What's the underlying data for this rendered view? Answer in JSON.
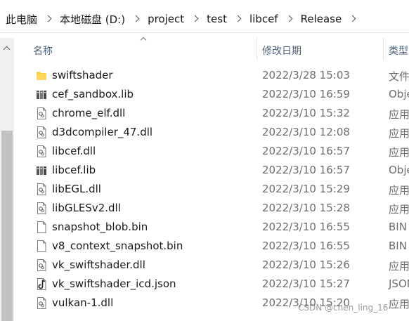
{
  "breadcrumb": [
    "此电脑",
    "本地磁盘 (D:)",
    "project",
    "test",
    "libcef",
    "Release"
  ],
  "columns": {
    "name": "名称",
    "date": "修改日期",
    "type": "类型"
  },
  "files": [
    {
      "name": "swiftshader",
      "date": "2022/3/28 15:03",
      "type": "文件",
      "icon": "folder-icon"
    },
    {
      "name": "cef_sandbox.lib",
      "date": "2022/3/10 16:59",
      "type": "Obje",
      "icon": "library-file-icon"
    },
    {
      "name": "chrome_elf.dll",
      "date": "2022/3/10 15:32",
      "type": "应用",
      "icon": "dll-file-icon"
    },
    {
      "name": "d3dcompiler_47.dll",
      "date": "2022/3/10 12:08",
      "type": "应用",
      "icon": "dll-file-icon"
    },
    {
      "name": "libcef.dll",
      "date": "2022/3/10 16:57",
      "type": "应用",
      "icon": "dll-file-icon"
    },
    {
      "name": "libcef.lib",
      "date": "2022/3/10 16:57",
      "type": "Obje",
      "icon": "library-file-icon"
    },
    {
      "name": "libEGL.dll",
      "date": "2022/3/10 15:29",
      "type": "应用",
      "icon": "dll-file-icon"
    },
    {
      "name": "libGLESv2.dll",
      "date": "2022/3/10 15:28",
      "type": "应用",
      "icon": "dll-file-icon"
    },
    {
      "name": "snapshot_blob.bin",
      "date": "2022/3/10 16:55",
      "type": "BIN",
      "icon": "blank-file-icon"
    },
    {
      "name": "v8_context_snapshot.bin",
      "date": "2022/3/10 16:55",
      "type": "BIN",
      "icon": "blank-file-icon"
    },
    {
      "name": "vk_swiftshader.dll",
      "date": "2022/3/10 15:26",
      "type": "应用",
      "icon": "dll-file-icon"
    },
    {
      "name": "vk_swiftshader_icd.json",
      "date": "2022/3/10 15:27",
      "type": "JSON",
      "icon": "json-file-icon"
    },
    {
      "name": "vulkan-1.dll",
      "date": "2022/3/10 15:20",
      "type": "应用",
      "icon": "dll-file-icon"
    }
  ],
  "watermark": "CSDN @chen_ling_16"
}
